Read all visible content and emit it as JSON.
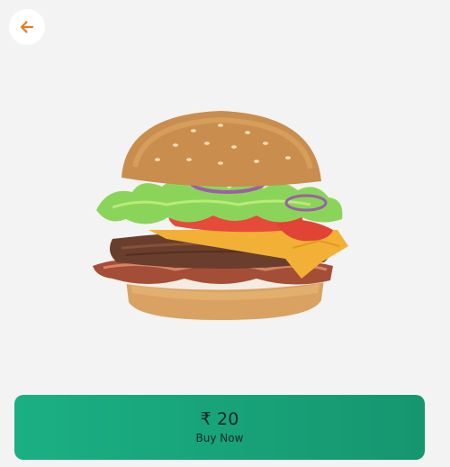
{
  "header": {
    "back_icon": "arrow-left-icon",
    "accent_color": "#e97a1a"
  },
  "product": {
    "image": "burger-image"
  },
  "purchase": {
    "price": "₹ 20",
    "button_label": "Buy Now",
    "gradient_start": "#1ab083",
    "gradient_end": "#16966f"
  }
}
